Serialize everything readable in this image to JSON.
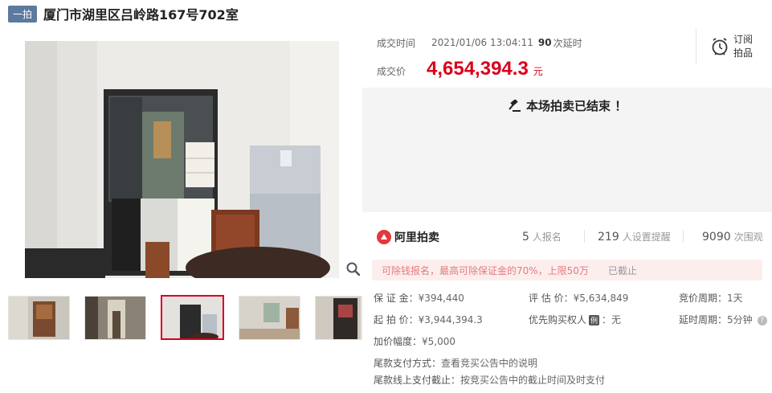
{
  "header": {
    "badge": "一拍",
    "title": "厦门市湖里区吕岭路167号702室"
  },
  "deal": {
    "time_label": "成交时间",
    "time": "2021/01/06 13:04:11",
    "delay_count": "90",
    "delay_unit": "次延时",
    "price_label": "成交价",
    "price": "4,654,394.3",
    "price_unit": "元"
  },
  "subscribe": {
    "line1": "订阅",
    "line2": "拍品"
  },
  "status": {
    "ended_text": "本场拍卖已结束 ！"
  },
  "platform": {
    "name": "阿里拍卖"
  },
  "stats": [
    {
      "num": "5",
      "label": "人报名"
    },
    {
      "num": "219",
      "label": "人设置提醒"
    },
    {
      "num": "9090",
      "label": "次围观"
    }
  ],
  "notice": {
    "text": "可除钱报名，最高可除保证金的70%，上限50万",
    "end": "已截止"
  },
  "details": {
    "deposit_label": "保 证 金：",
    "deposit": "¥394,440",
    "start_label": "起 拍 价：",
    "start": "¥3,944,394.3",
    "increment_label": "加价幅度：",
    "increment": "¥5,000",
    "estimate_label": "评 估 价：",
    "estimate": "¥5,634,849",
    "priority_label": "优先购买权人",
    "priority_tag": "例",
    "priority_value": "：无",
    "period_label": "竞价周期：",
    "period": "1天",
    "delay_label": "延时周期：",
    "delay": "5分钟",
    "pay_method_label": "尾款支付方式：",
    "pay_method": "查看竞买公告中的说明",
    "pay_deadline_label": "尾款线上支付截止：",
    "pay_deadline": "按竞买公告中的截止时间及时支付"
  },
  "colors": {
    "accent": "#d9001b",
    "badge": "#5b7a9e",
    "panel": "#f4f4f4"
  }
}
